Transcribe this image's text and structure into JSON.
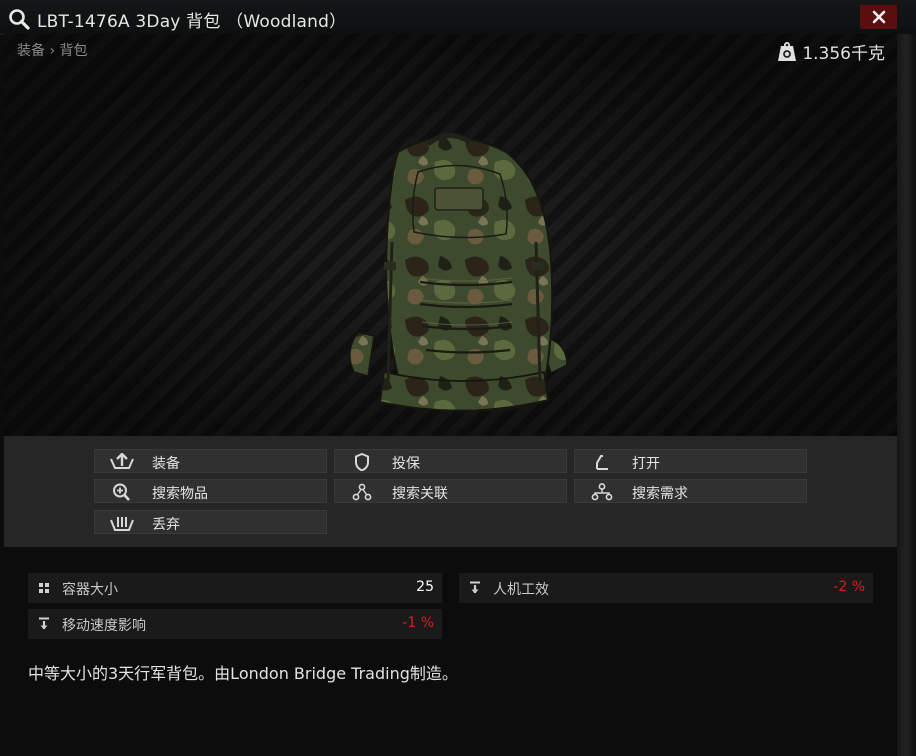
{
  "window": {
    "title": "LBT-1476A 3Day 背包 （Woodland）",
    "close_label": "✕"
  },
  "preview": {
    "breadcrumb": "装备 › 背包",
    "weight": "1.356千克",
    "item_image": "camo-backpack-image"
  },
  "actions": [
    {
      "label": "装备",
      "icon": "equip-icon"
    },
    {
      "label": "投保",
      "icon": "insure-shield-icon"
    },
    {
      "label": "打开",
      "icon": "open-icon"
    },
    {
      "label": "搜索物品",
      "icon": "search-item-icon"
    },
    {
      "label": "搜索关联",
      "icon": "search-linked-icon"
    },
    {
      "label": "搜索需求",
      "icon": "search-required-icon"
    },
    {
      "label": "丢弃",
      "icon": "discard-icon"
    }
  ],
  "stats": [
    {
      "name": "容器大小",
      "value": "25",
      "value_color": "#ffffff",
      "icon": "grid-icon"
    },
    {
      "name": "人机工效",
      "value": "-2 %",
      "value_color": "#d42020",
      "icon": "down-arrow-icon"
    },
    {
      "name": "移动速度影响",
      "value": "-1 %",
      "value_color": "#d42020",
      "icon": "down-arrow-icon"
    }
  ],
  "description": "中等大小的3天行军背包。由London Bridge Trading制造。"
}
